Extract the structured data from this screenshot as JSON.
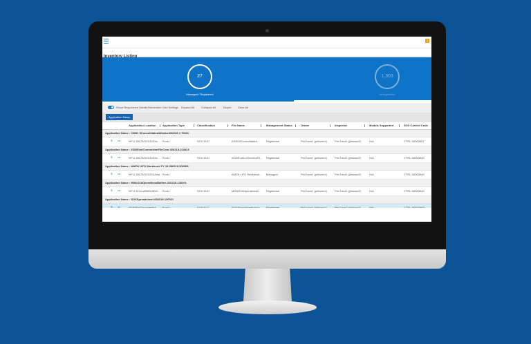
{
  "app": {
    "title": "Inventory Listing",
    "alert_badge": "1"
  },
  "stats": [
    {
      "value": "27",
      "label": "Managed / Registered"
    },
    {
      "value": "1,303",
      "label": "Unregistered"
    }
  ],
  "toolbar": {
    "toggle_label": "Show Responsive Details",
    "remember_grid": "Remember Grid Settings",
    "expand_all": "Expand All",
    "collapse_all": "Collapse All",
    "export": "Export",
    "clear_all": "Clear All"
  },
  "group_by": {
    "chip": "Application Name"
  },
  "columns": [
    "Application Location",
    "Application Type",
    "Classification",
    "File Name",
    "Management Status",
    "Owner",
    "Inspector",
    "Models Supported",
    "SOX Control Code"
  ],
  "groups": [
    {
      "title": "Application Name : 03091 9ConsolidatedAtlanta-080219-1 75321",
      "row": [
        "NP-0 30175/SCIDS/Dis...",
        "Excel",
        "SOX EUC",
        "030919Consolidated...",
        "Registered",
        "Phil User1 (philuser1)",
        "Phil User2 (philuser2)",
        "N/A",
        "CTRL-00004567"
      ]
    },
    {
      "title": "Application Name : 2020EvalConnectionFileCom-020219-210823",
      "row": [
        "NP-0 30175/SCIDS/Dis...",
        "Excel",
        "SOX EUC",
        "2020EvalConnectionFil...",
        "Registered",
        "Phil User1 (philuser1)",
        "Phil User2 (philuser2)",
        "N/A",
        "CTRL-00004545"
      ]
    },
    {
      "title": "Application Name : AMZN LIFO Workbook FY 19-080219-500368",
      "row": [
        "NP-0 30175/SCIDS/Unna...",
        "Excel",
        "",
        "AMZN LIFO Workbook ...",
        "Managed",
        "Phil User1 (philuser1)",
        "Phil User2 (philuser2)",
        "N/A",
        "CTRL-00004545"
      ]
    },
    {
      "title": "Application Name : M092219OperationsBatline-020219-130201",
      "row": [
        "NP-0 310/Lsl/BIZDAR/K...",
        "Excel",
        "SOX EUC",
        "M092219OperationsB...",
        "Registered",
        "Phil User1 (philuser1)",
        "Phil User2 (philuser2)",
        "N/A",
        "CTRL-00004545"
      ]
    },
    {
      "title": "Application Name : SOXSpreadsheet-080219-130321",
      "row": [
        "HDB\\PickDocumentsA...",
        "Excel",
        "SOX EUC",
        "SOXSpreadsheet.xlsm",
        "Registered",
        "Phil User1 (philuser1)",
        "Phil User2 (philuser2)",
        "N/A",
        "CTRL-00004568"
      ]
    }
  ]
}
